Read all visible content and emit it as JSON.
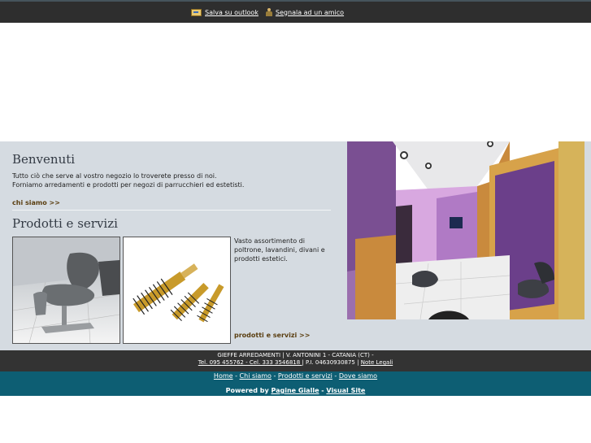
{
  "toolbar": {
    "save_outlook": "Salva su outlook",
    "tell_friend": "Segnala ad un amico"
  },
  "welcome": {
    "title": "Benvenuti",
    "line1": "Tutto ciò che serve al vostro negozio lo troverete  presso di noi.",
    "line2": "Forniamo arredamenti e prodotti per negozi di parrucchieri ed estetisti.",
    "link": "chi siamo >>"
  },
  "products": {
    "title": "Prodotti e servizi",
    "description": "Vasto assortimento di poltrone, lavandini, divani e prodotti estetici.",
    "link": "prodotti e servizi >>"
  },
  "footer": {
    "company": "GIEFFE ARREDAMENTI | V. ANTONINI 1  - CATANIA (CT) -",
    "contacts": "Tel. 095 455762 - Cel. 333 3546818 |",
    "vat": " P.I. 04630930875 | ",
    "legal": "Note Legali",
    "nav": [
      "Home",
      "Chi siamo",
      "Prodotti e servizi",
      "Dove siamo"
    ],
    "nav_sep": " - ",
    "powered_prefix": "Powered by ",
    "powered_1": "Pagine Gialle",
    "powered_sep": " - ",
    "powered_2": "Visual Site"
  }
}
